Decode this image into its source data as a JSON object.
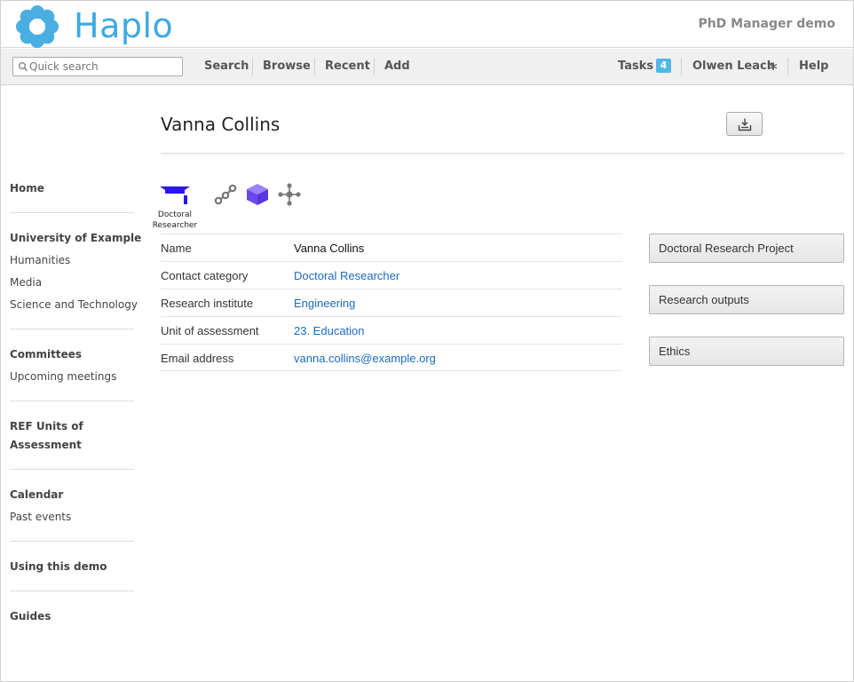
{
  "header": {
    "logo_text": "Haplo",
    "app_name": "PhD Manager demo"
  },
  "navbar": {
    "search_placeholder": "Quick search",
    "links": {
      "search": "Search",
      "browse": "Browse",
      "recent": "Recent",
      "add": "Add"
    },
    "tasks_label": "Tasks",
    "tasks_count": "4",
    "user_name": "Olwen Leach",
    "help": "Help"
  },
  "sidebar": {
    "home": "Home",
    "university": "University of Example",
    "humanities": "Humanities",
    "media": "Media",
    "science": "Science and Technology",
    "committees": "Committees",
    "upcoming": "Upcoming meetings",
    "ref_line1": "REF Units of",
    "ref_line2": "Assessment",
    "calendar": "Calendar",
    "past_events": "Past events",
    "using_demo": "Using this demo",
    "guides": "Guides"
  },
  "record": {
    "title": "Vanna Collins",
    "type_label_line1": "Doctoral",
    "type_label_line2": "Researcher",
    "attributes": [
      {
        "label": "Name",
        "value": "Vanna Collins"
      },
      {
        "label": "Contact category",
        "value": "Doctoral Researcher"
      },
      {
        "label": "Research institute",
        "value": "Engineering"
      },
      {
        "label": "Unit of assessment",
        "value": "23. Education"
      },
      {
        "label": "Email address",
        "value": "vanna.collins@example.org"
      }
    ]
  },
  "actions": {
    "project": "Doctoral Research Project",
    "outputs": "Research outputs",
    "ethics": "Ethics"
  },
  "colors": {
    "brand": "#3fa9e1",
    "link": "#1a6bbf",
    "badge": "#4fb6e8",
    "type_icon": "#2a16e8",
    "cube_icon": "#7b5cf0"
  }
}
